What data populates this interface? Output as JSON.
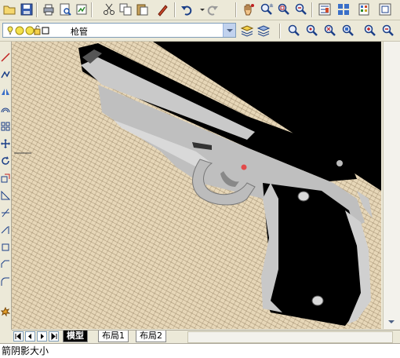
{
  "layer_toolbar": {
    "current_layer": "枪管"
  },
  "layout_tabs": {
    "items": [
      {
        "label": "模型"
      },
      {
        "label": "布局1"
      },
      {
        "label": "布局2"
      }
    ],
    "active": "模型"
  },
  "command_line": {
    "text": "箭阴影大小"
  },
  "icons": {
    "toolbar1": [
      "open-icon",
      "save-icon",
      "print-icon",
      "print-preview-icon",
      "publish-icon",
      "cut-icon",
      "copy-icon",
      "paste-icon",
      "match-properties-icon",
      "undo-icon",
      "redo-icon",
      "pan-icon",
      "zoom-realtime-icon",
      "zoom-window-icon",
      "zoom-previous-icon",
      "properties-icon",
      "design-center-icon",
      "tool-palettes-icon"
    ],
    "toolbar2": [
      "layer-manager-icon",
      "layer-previous-icon",
      "zoom-in-icon",
      "zoom-out-icon",
      "zoom-all-icon",
      "zoom-extents-icon"
    ],
    "left": [
      "line-icon",
      "polyline-icon",
      "mirror-icon",
      "offset-icon",
      "array-icon",
      "move-icon",
      "rotate-icon",
      "scale-icon",
      "stretch-icon",
      "trim-icon",
      "extend-icon",
      "break-icon",
      "chamfer-icon",
      "fillet-icon",
      "explode-icon"
    ]
  },
  "colors": {
    "viewport_background": "#e7d7b8",
    "gun_body": "#000000",
    "gun_metal": "#c8c8c8",
    "toolbar": "#ece9d8"
  }
}
